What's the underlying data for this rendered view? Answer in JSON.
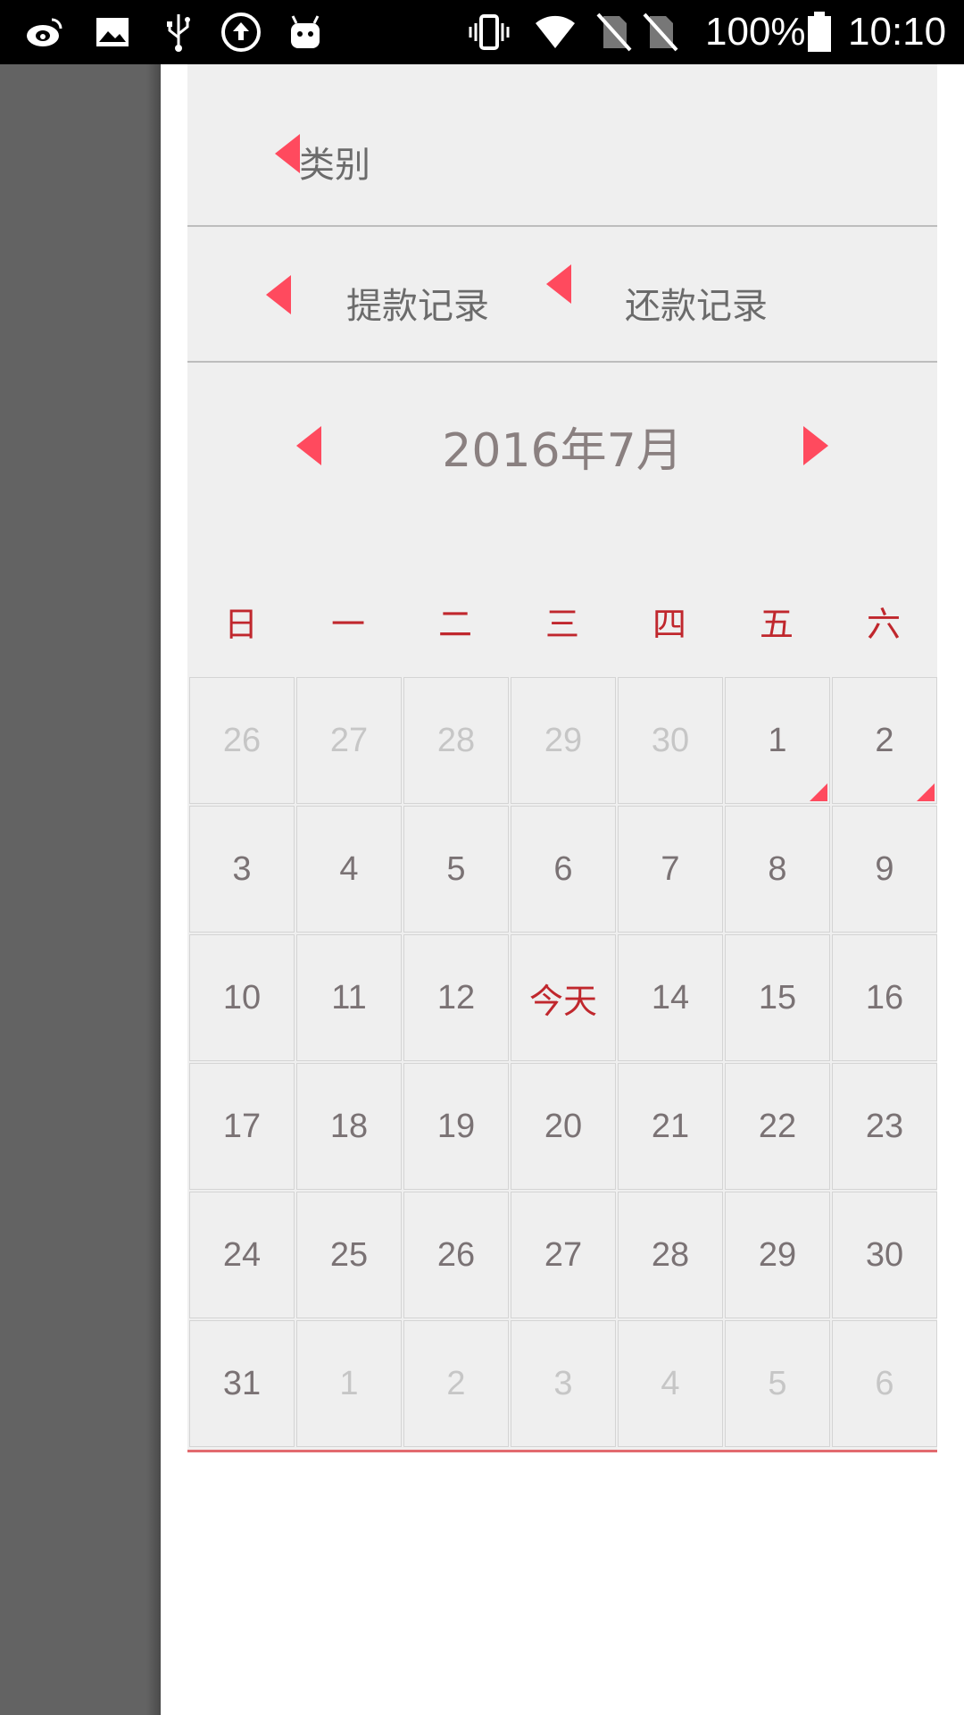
{
  "status_bar": {
    "icons": [
      "weibo-icon",
      "image-icon",
      "usb-icon",
      "upload-icon",
      "android-icon",
      "vibrate-icon",
      "wifi-icon",
      "no-sim-icon",
      "no-sim-icon",
      "battery-icon"
    ],
    "battery_text": "100%",
    "clock": "10:10"
  },
  "drawer": {
    "category_label": "类别",
    "records": {
      "withdraw_label": "提款记录",
      "repay_label": "还款记录"
    },
    "calendar": {
      "month_title": "2016年7月",
      "weekdays": [
        "日",
        "一",
        "二",
        "三",
        "四",
        "五",
        "六"
      ],
      "weeks": [
        [
          "26",
          "27",
          "28",
          "29",
          "30",
          "1",
          "2"
        ],
        [
          "3",
          "4",
          "5",
          "6",
          "7",
          "8",
          "9"
        ],
        [
          "10",
          "11",
          "12",
          "今天",
          "14",
          "15",
          "16"
        ],
        [
          "17",
          "18",
          "19",
          "20",
          "21",
          "22",
          "23"
        ],
        [
          "24",
          "25",
          "26",
          "27",
          "28",
          "29",
          "30"
        ],
        [
          "31",
          "1",
          "2",
          "3",
          "4",
          "5",
          "6"
        ]
      ],
      "muted_cells": [
        [
          0,
          0
        ],
        [
          0,
          1
        ],
        [
          0,
          2
        ],
        [
          0,
          3
        ],
        [
          0,
          4
        ],
        [
          5,
          1
        ],
        [
          5,
          2
        ],
        [
          5,
          3
        ],
        [
          5,
          4
        ],
        [
          5,
          5
        ],
        [
          5,
          6
        ]
      ],
      "today_cell": [
        2,
        3
      ],
      "marked_cells": [
        [
          0,
          5
        ],
        [
          0,
          6
        ]
      ]
    },
    "colors": {
      "accent": "#ff4a5e",
      "weekday_text": "#c0272d",
      "panel_bg": "#efefef",
      "scrim": "#636363"
    }
  }
}
